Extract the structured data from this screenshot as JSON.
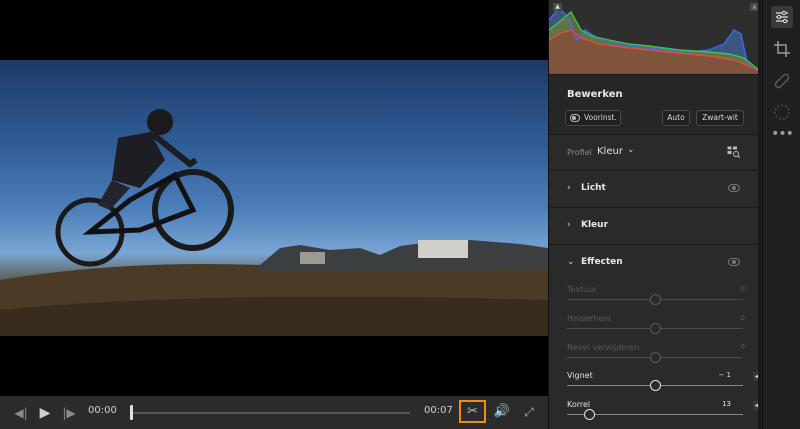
{
  "player": {
    "time_current": "00:00",
    "time_end": "00:07",
    "playhead_fraction": 0.0,
    "preview_scrub_fraction": 0.41
  },
  "panel": {
    "title": "Bewerken",
    "presets_label": "Voorinst.",
    "auto_label": "Auto",
    "bw_label": "Zwart-wit",
    "profile_label": "Profiel",
    "profile_value": "Kleur"
  },
  "sections": {
    "licht": "Licht",
    "kleur": "Kleur",
    "effecten": "Effecten"
  },
  "effects": [
    {
      "label": "Textuur",
      "value": "0",
      "position": 0.5,
      "active": false
    },
    {
      "label": "Helderheid",
      "value": "0",
      "position": 0.5,
      "active": false
    },
    {
      "label": "Nevel verwijderen",
      "value": "0",
      "position": 0.5,
      "active": false
    },
    {
      "label": "Vignet",
      "value": "− 1",
      "position": 0.5,
      "active": true
    },
    {
      "label": "Korrel",
      "value": "13",
      "position": 0.13,
      "active": true
    }
  ],
  "icons": {
    "prev_frame": "step-back-icon",
    "play": "play-icon",
    "next_frame": "step-forward-icon",
    "trim": "scissors-icon",
    "volume": "volume-icon",
    "fullscreen": "expand-icon",
    "edit_tool": "sliders-icon",
    "crop_tool": "crop-icon",
    "heal_tool": "bandage-icon",
    "mask_tool": "mask-icon",
    "more": "more-icon"
  },
  "colors": {
    "accent_highlight": "#f28a1a",
    "panel_bg": "#2a2a2a"
  }
}
